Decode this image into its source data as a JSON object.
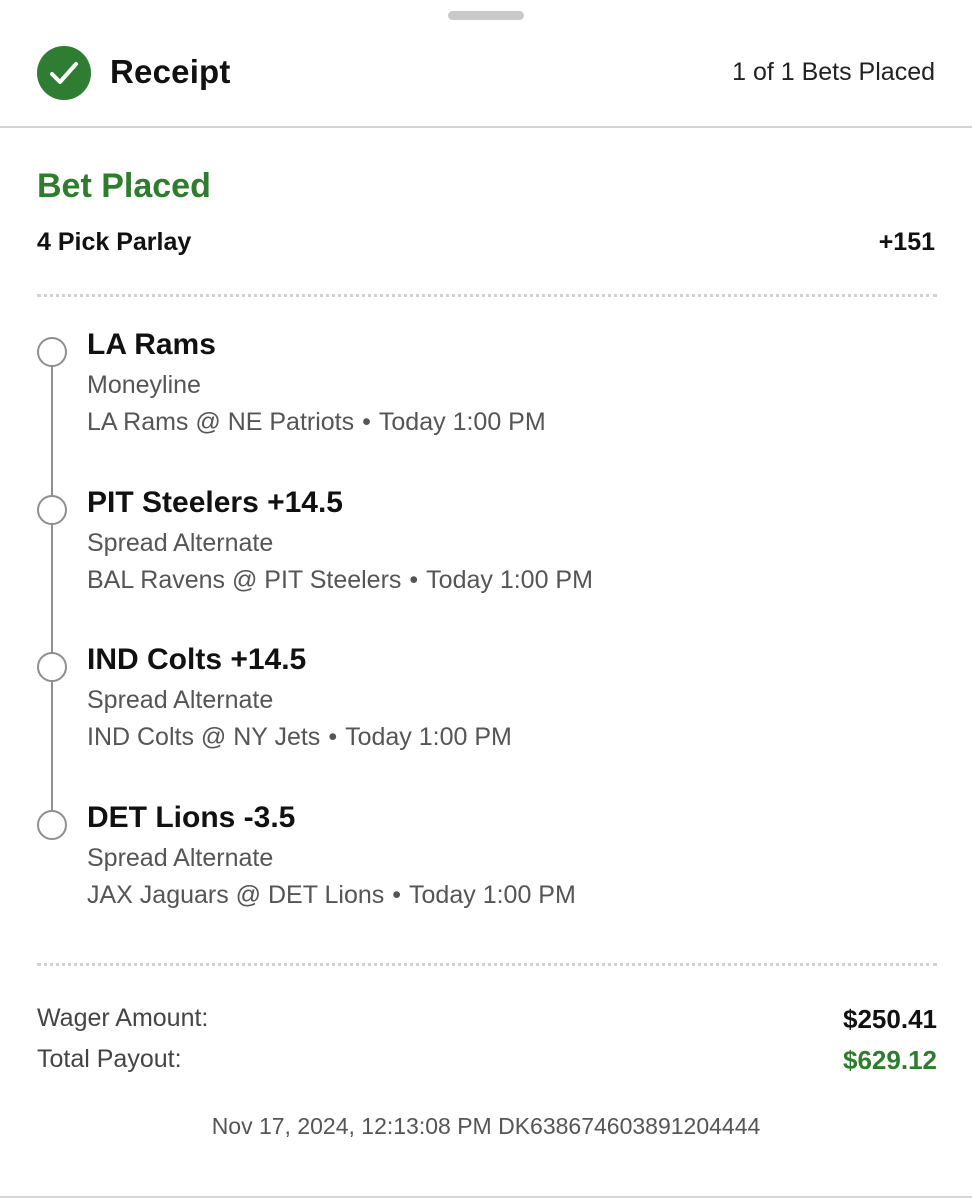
{
  "header": {
    "title": "Receipt",
    "bets_placed": "1 of 1 Bets Placed",
    "status_icon": "check-circle-icon",
    "accent_color": "#2e7d32"
  },
  "bet": {
    "status": "Bet Placed",
    "type": "4 Pick Parlay",
    "odds": "+151"
  },
  "legs": [
    {
      "pick": "LA Rams",
      "market": "Moneyline",
      "matchup": "LA Rams @ NE Patriots",
      "separator": "•",
      "time": "Today 1:00 PM"
    },
    {
      "pick": "PIT Steelers +14.5",
      "market": "Spread Alternate",
      "matchup": "BAL Ravens @ PIT Steelers",
      "separator": "•",
      "time": "Today 1:00 PM"
    },
    {
      "pick": "IND Colts +14.5",
      "market": "Spread Alternate",
      "matchup": "IND Colts @ NY Jets",
      "separator": "•",
      "time": "Today 1:00 PM"
    },
    {
      "pick": "DET Lions -3.5",
      "market": "Spread Alternate",
      "matchup": "JAX Jaguars @ DET Lions",
      "separator": "•",
      "time": "Today 1:00 PM"
    }
  ],
  "summary": {
    "wager_label": "Wager Amount:",
    "wager_value": "$250.41",
    "payout_label": "Total Payout:",
    "payout_value": "$629.12",
    "payout_color": "#2e7d2c"
  },
  "footer": {
    "timestamp_and_id": "Nov 17, 2024, 12:13:08 PM DK638674603891204444"
  }
}
